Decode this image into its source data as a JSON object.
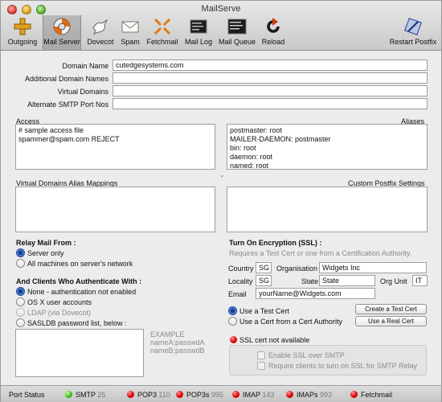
{
  "window": {
    "title": "MailServe"
  },
  "toolbar": {
    "items": [
      {
        "label": "Outgoing",
        "icon": "plus-icon"
      },
      {
        "label": "Mail Server",
        "icon": "lifebuoy-icon"
      },
      {
        "label": "Dovecot",
        "icon": "dove-icon"
      },
      {
        "label": "Spam",
        "icon": "envelope-icon"
      },
      {
        "label": "Fetchmail",
        "icon": "fetch-arrows-icon"
      },
      {
        "label": "Mail Log",
        "icon": "console-log-icon"
      },
      {
        "label": "Mail Queue",
        "icon": "console-queue-icon"
      },
      {
        "label": "Reload",
        "icon": "reload-icon"
      },
      {
        "label": "Restart Postfix",
        "icon": "restart-icon"
      }
    ],
    "queue_icon_text": "Queue ID\nV7380\nD8DE"
  },
  "fields": {
    "domain_name": {
      "label": "Domain Name",
      "value": "cutedgesystems.com"
    },
    "additional_domains": {
      "label": "Additional Domain Names",
      "value": ""
    },
    "virtual_domains": {
      "label": "Virtual Domains",
      "value": ""
    },
    "alt_smtp": {
      "label": "Alternate SMTP Port Nos",
      "value": ""
    }
  },
  "access": {
    "label": "Access",
    "lines": [
      "# sample access file",
      "spammer@spam.com REJECT"
    ]
  },
  "aliases": {
    "label": "Aliases",
    "lines": [
      "postmaster: root",
      "MAILER-DAEMON: postmaster",
      "bin: root",
      "daemon: root",
      "named: root"
    ]
  },
  "vdam": {
    "label": "Virtual Domains Alias Mappings"
  },
  "postfix_custom": {
    "label": "Custom Postfix Settings"
  },
  "relay": {
    "title": "Relay Mail From :",
    "options": [
      "Server only",
      "All machines on server's network"
    ],
    "selected": 0
  },
  "auth": {
    "title": "And Clients Who Authenticate With :",
    "options": [
      "None - authentication not enabled",
      "OS X user accounts",
      "LDAP (via Dovecot)",
      "SASLDB password list, below :"
    ],
    "selected": 0,
    "example": [
      "EXAMPLE",
      "nameA:passwdA",
      "nameB:passwdB"
    ]
  },
  "ssl": {
    "title": "Turn On Encryption (SSL) :",
    "subtitle": "Requires a Test Cert or one from a Certification Authority.",
    "country_label": "Country",
    "country": "SG",
    "org_label": "Organisation",
    "org": "Widgets Inc",
    "locality_label": "Locality",
    "locality": "SG",
    "state_label": "State",
    "state": "State",
    "orgunit_label": "Org Unit",
    "orgunit": "IT",
    "email_label": "Email",
    "email": "yourName@Widgets.com",
    "cert_options": [
      "Use a Test Cert",
      "Use a Cert from a Cert Authority"
    ],
    "cert_selected": 0,
    "create_test_btn": "Create a Test Cert",
    "use_real_btn": "Use a Real Cert",
    "status": "SSL cert not available",
    "enable_smtp": "Enable SSL over SMTP",
    "require_clients": "Require clients to turn on SSL for SMTP Relay"
  },
  "statusbar": {
    "label": "Port Status",
    "ports": [
      {
        "name": "SMTP",
        "port": "25",
        "status": "green"
      },
      {
        "name": "POP3",
        "port": "110",
        "status": "red"
      },
      {
        "name": "POP3s",
        "port": "995",
        "status": "red"
      },
      {
        "name": "IMAP",
        "port": "143",
        "status": "red"
      },
      {
        "name": "IMAPs",
        "port": "993",
        "status": "red"
      },
      {
        "name": "Fetchmail",
        "port": "",
        "status": "red"
      }
    ]
  },
  "colors": {
    "accent": "#2a5fd0",
    "status_green": "#3cc21a",
    "status_red": "#e00000"
  }
}
